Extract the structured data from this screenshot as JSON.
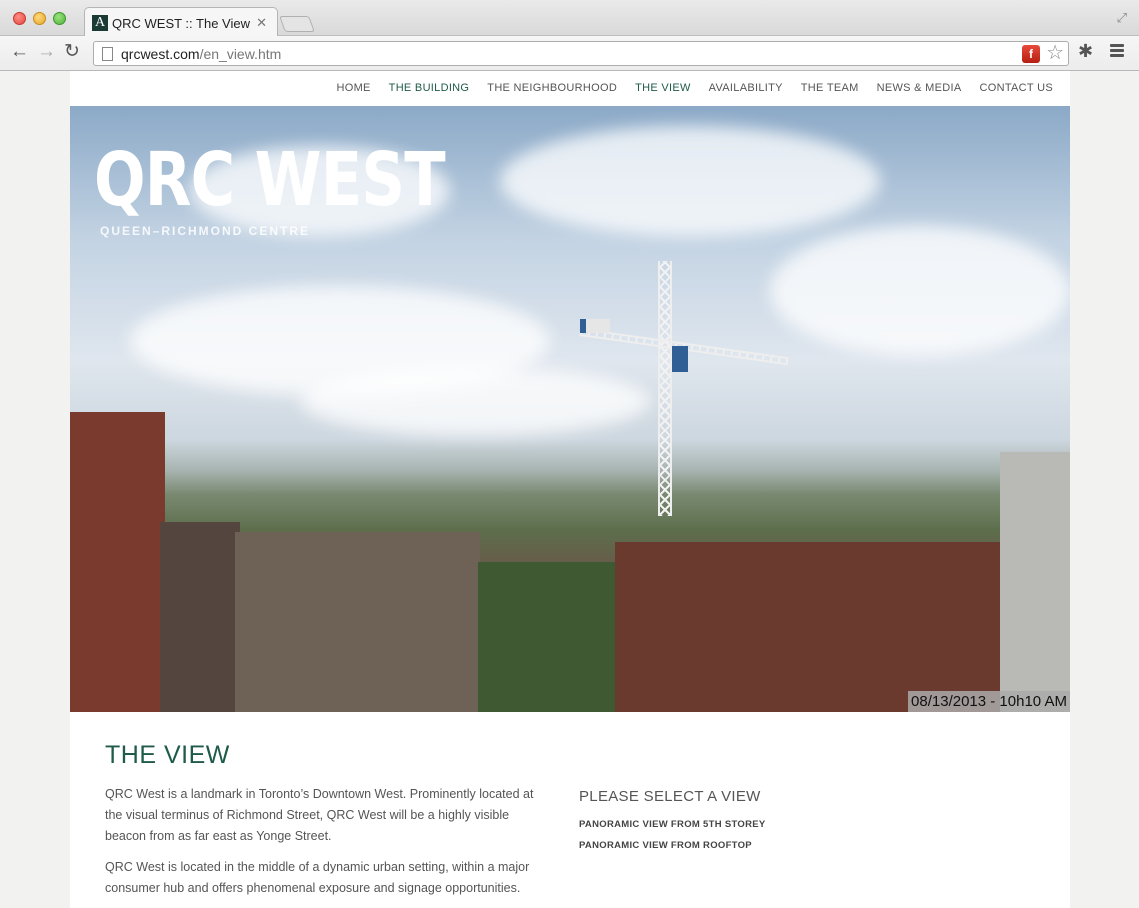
{
  "browser": {
    "tab_title": "QRC WEST :: The View",
    "tab_favicon_letter": "A",
    "url_host": "qrcwest.com",
    "url_path": "/en_view.htm"
  },
  "nav": {
    "items": [
      {
        "label": "HOME",
        "active": false
      },
      {
        "label": "THE BUILDING",
        "active": true
      },
      {
        "label": "THE NEIGHBOURHOOD",
        "active": false
      },
      {
        "label": "THE VIEW",
        "active": true
      },
      {
        "label": "AVAILABILITY",
        "active": false
      },
      {
        "label": "THE TEAM",
        "active": false
      },
      {
        "label": "NEWS & MEDIA",
        "active": false
      },
      {
        "label": "CONTACT US",
        "active": false
      }
    ]
  },
  "hero": {
    "logo_title": "QRC WEST",
    "logo_subtitle": "QUEEN–RICHMOND CENTRE",
    "timestamp": "08/13/2013 - 10h10 AM"
  },
  "content": {
    "title": "THE VIEW",
    "paragraphs": [
      "QRC West is a landmark in Toronto’s Downtown West. Prominently located at the visual terminus of Richmond Street, QRC West will be a highly visible beacon from as far east as Yonge Street.",
      "QRC West is located in the middle of a dynamic urban setting, within a major consumer hub and offers phenomenal exposure and signage opportunities."
    ]
  },
  "views": {
    "heading": "PLEASE SELECT A VIEW",
    "links": [
      "PANORAMIC VIEW FROM 5TH STOREY",
      "PANORAMIC VIEW FROM ROOFTOP"
    ]
  },
  "colors": {
    "accent": "#1f5a4a",
    "text": "#555555"
  }
}
